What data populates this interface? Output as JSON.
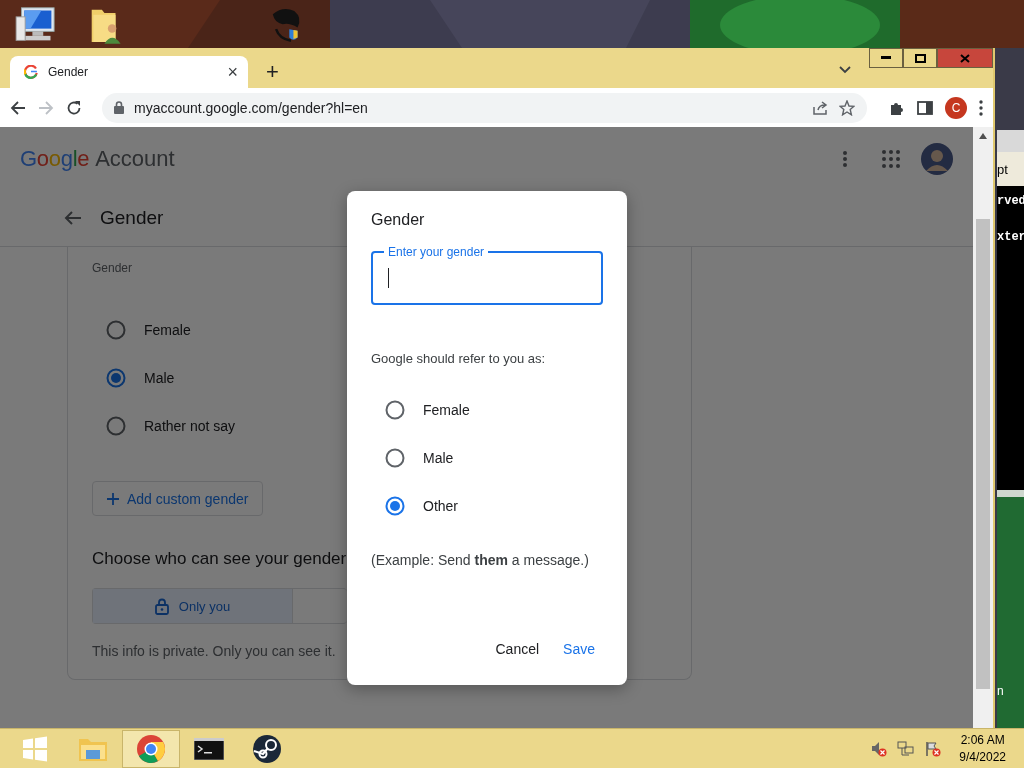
{
  "browser": {
    "tab_title": "Gender",
    "tab_close": "×",
    "new_tab": "+",
    "url": "myaccount.google.com/gender?hl=en",
    "profile_initial": "C"
  },
  "page": {
    "logo": "Google",
    "product": "Account",
    "heading": "Gender",
    "section_label": "Gender",
    "options": [
      {
        "label": "Female",
        "selected": false
      },
      {
        "label": "Male",
        "selected": true
      },
      {
        "label": "Rather not say",
        "selected": false
      }
    ],
    "add_button": "Add custom gender",
    "visibility_heading": "Choose who can see your gender",
    "visibility_options": [
      {
        "label": "Only you",
        "selected": true
      }
    ],
    "privacy_note": "This info is private. Only you can see it."
  },
  "dialog": {
    "title": "Gender",
    "field": {
      "label": "Enter your gender",
      "focused": true
    },
    "refer_label": "Google should refer to you as:",
    "pronouns": [
      {
        "label": "Female",
        "selected": false
      },
      {
        "label": "Male",
        "selected": false
      },
      {
        "label": "Other",
        "selected": true
      }
    ],
    "example": "(Example: Send **them** a message.)",
    "buttons": [
      {
        "label": "Cancel",
        "kind": "text"
      },
      {
        "label": "Save",
        "kind": "primary"
      }
    ]
  },
  "background_window": {
    "title_fragment": "pt",
    "lines": [
      "rved",
      "xter"
    ],
    "footer_fragment": "n"
  },
  "taskbar": {
    "time": "2:06 AM",
    "date": "9/4/2022"
  }
}
